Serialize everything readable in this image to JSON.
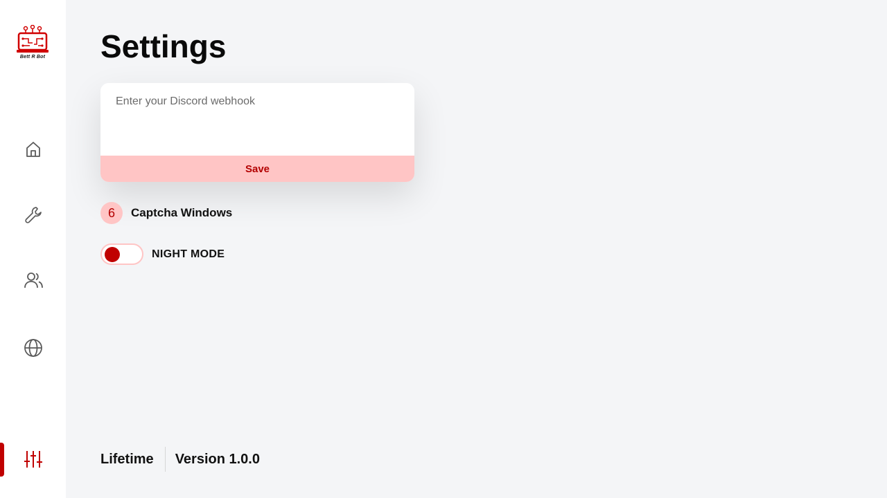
{
  "brand": {
    "logo_text": "Bett R Bot",
    "accent_color": "#c00000",
    "accent_light": "#ffc5c5"
  },
  "sidebar": {
    "items": [
      {
        "icon": "home-icon"
      },
      {
        "icon": "wrench-icon"
      },
      {
        "icon": "users-icon"
      },
      {
        "icon": "globe-icon"
      },
      {
        "icon": "sliders-icon",
        "active": true
      }
    ]
  },
  "page": {
    "title": "Settings"
  },
  "webhook": {
    "placeholder": "Enter your Discord webhook",
    "value": "",
    "save_label": "Save"
  },
  "captcha": {
    "count": "6",
    "label": "Captcha Windows"
  },
  "night_mode": {
    "label": "NIGHT MODE",
    "enabled": false
  },
  "footer": {
    "plan": "Lifetime",
    "version": "Version 1.0.0"
  }
}
